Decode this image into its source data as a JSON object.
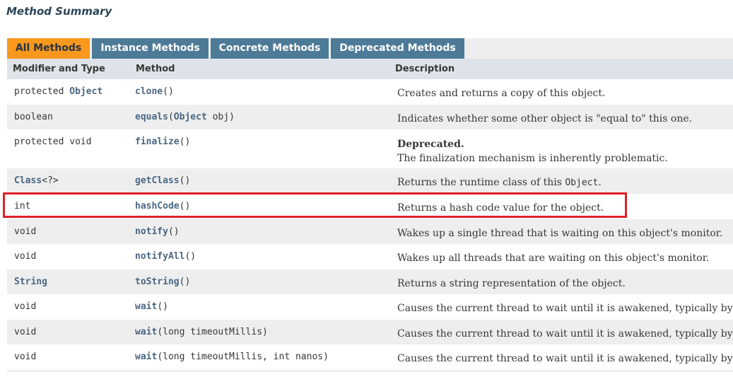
{
  "section_title": "Method Summary",
  "tabs": [
    {
      "label": "All Methods",
      "active": true
    },
    {
      "label": "Instance Methods",
      "active": false
    },
    {
      "label": "Concrete Methods",
      "active": false
    },
    {
      "label": "Deprecated Methods",
      "active": false
    }
  ],
  "columns": {
    "modifier": "Modifier and Type",
    "method": "Method",
    "description": "Description"
  },
  "rows": [
    {
      "mod_prefix": "protected ",
      "mod_link": "Object",
      "mod_suffix": "",
      "method_link": "clone",
      "method_rest": "()",
      "description": "Creates and returns a copy of this object."
    },
    {
      "mod_prefix": "boolean",
      "mod_link": "",
      "mod_suffix": "",
      "method_link": "equals",
      "method_rest_open": "(",
      "param_link": "Object",
      "method_rest": " obj)",
      "description": "Indicates whether some other object is \"equal to\" this one."
    },
    {
      "mod_prefix": "protected void",
      "mod_link": "",
      "mod_suffix": "",
      "method_link": "finalize",
      "method_rest": "()",
      "deprecated_label": "Deprecated.",
      "description": "The finalization mechanism is inherently problematic."
    },
    {
      "mod_prefix": "",
      "mod_link": "Class",
      "mod_suffix": "<?>",
      "method_link": "getClass",
      "method_rest": "()",
      "description": "Returns the runtime class of this ",
      "description_code": "Object",
      "description_end": "."
    },
    {
      "mod_prefix": "int",
      "mod_link": "",
      "mod_suffix": "",
      "method_link": "hashCode",
      "method_rest": "()",
      "description": "Returns a hash code value for the object.",
      "highlighted": true
    },
    {
      "mod_prefix": "void",
      "mod_link": "",
      "mod_suffix": "",
      "method_link": "notify",
      "method_rest": "()",
      "description": "Wakes up a single thread that is waiting on this object's monitor."
    },
    {
      "mod_prefix": "void",
      "mod_link": "",
      "mod_suffix": "",
      "method_link": "notifyAll",
      "method_rest": "()",
      "description": "Wakes up all threads that are waiting on this object's monitor."
    },
    {
      "mod_prefix": "",
      "mod_link": "String",
      "mod_suffix": "",
      "method_link": "toString",
      "method_rest": "()",
      "description": "Returns a string representation of the object."
    },
    {
      "mod_prefix": "void",
      "mod_link": "",
      "mod_suffix": "",
      "method_link": "wait",
      "method_rest": "()",
      "description": "Causes the current thread to wait until it is awakened, typically by"
    },
    {
      "mod_prefix": "void",
      "mod_link": "",
      "mod_suffix": "",
      "method_link": "wait",
      "method_rest": "(long timeoutMillis)",
      "description": "Causes the current thread to wait until it is awakened, typically by"
    },
    {
      "mod_prefix": "void",
      "mod_link": "",
      "mod_suffix": "",
      "method_link": "wait",
      "method_rest": "(long timeoutMillis, int nanos)",
      "description": "Causes the current thread to wait until it is awakened, typically by"
    }
  ],
  "colors": {
    "active_tab": "#f8981d",
    "tab": "#4d7a97",
    "link": "#4a6782",
    "highlight_border": "#e0202a"
  }
}
